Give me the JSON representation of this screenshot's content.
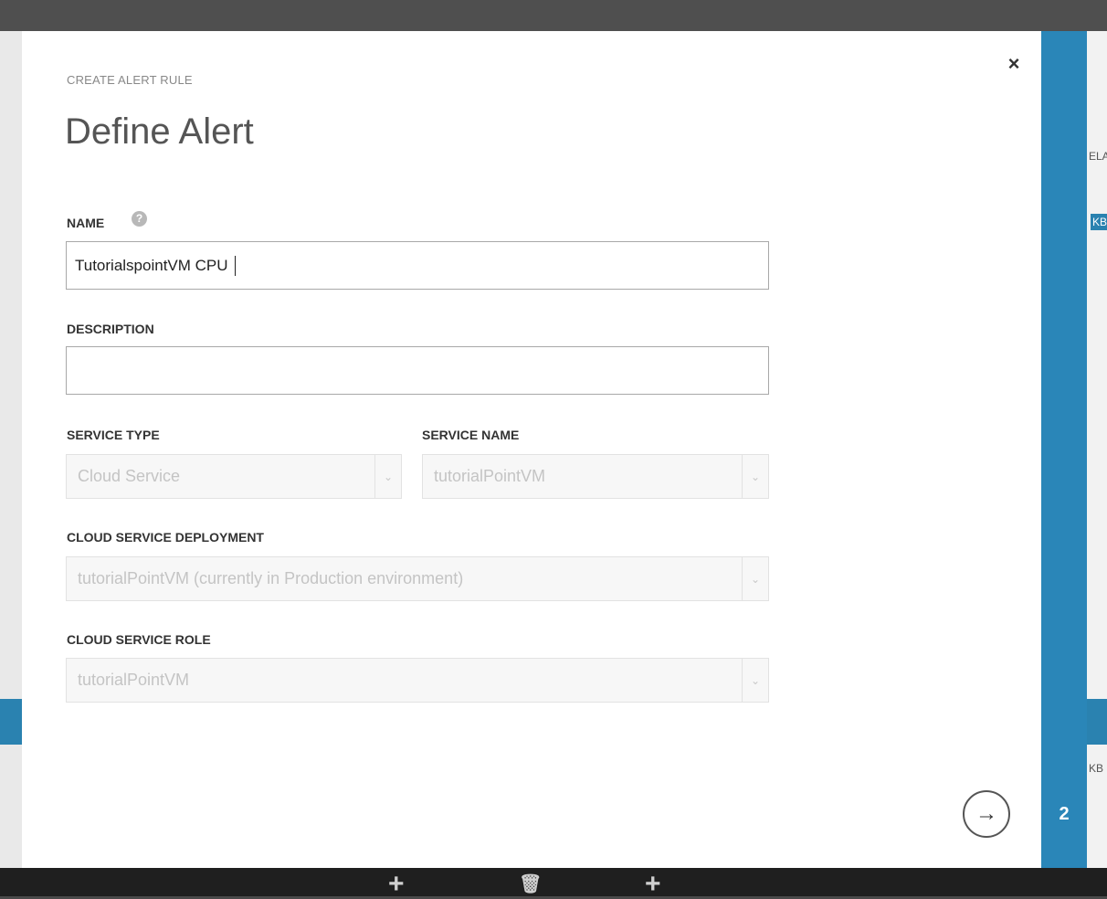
{
  "dialog": {
    "subtitle": "CREATE ALERT RULE",
    "title": "Define Alert",
    "close_icon": "×",
    "step_number": "2",
    "next_icon": "→"
  },
  "fields": {
    "name_label": "NAME",
    "name_help": "?",
    "name_value": "TutorialspointVM CPU",
    "description_label": "DESCRIPTION",
    "description_value": "",
    "service_type_label": "SERVICE TYPE",
    "service_type_value": "Cloud Service",
    "service_name_label": "SERVICE NAME",
    "service_name_value": "tutorialPointVM",
    "deployment_label": "CLOUD SERVICE DEPLOYMENT",
    "deployment_value": "tutorialPointVM (currently in Production environment)",
    "role_label": "CLOUD SERVICE ROLE",
    "role_value": "tutorialPointVM"
  },
  "background": {
    "peek_texts": [
      "ELA",
      "KB",
      "KB"
    ],
    "bottom_icons": [
      "+",
      "🗑",
      "+"
    ]
  },
  "icons": {
    "close": "close-icon",
    "help": "help-icon",
    "chevron": "chevron-down-icon",
    "next": "arrow-right-icon"
  },
  "colors": {
    "accent": "#2a86b8",
    "overlay": "#4a4a4a"
  }
}
